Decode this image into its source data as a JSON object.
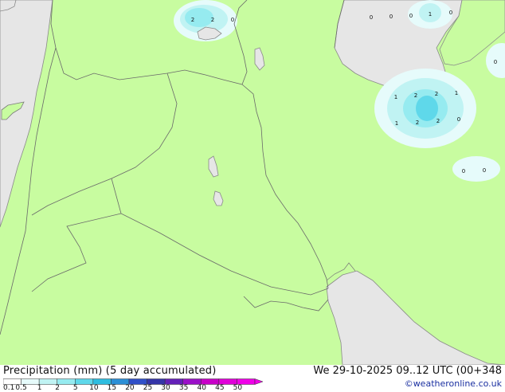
{
  "title": "Precipitation (mm) (5 day accumulated)",
  "datetime": "We 29-10-2025 09..12 UTC (00+348",
  "credit": "©weatheronline.co.uk",
  "legend": {
    "ticks": [
      "0.1",
      "0.5",
      "1",
      "2",
      "5",
      "10",
      "15",
      "20",
      "25",
      "30",
      "35",
      "40",
      "45",
      "50"
    ],
    "colors": [
      "#ffffff",
      "#e6fbfb",
      "#c0f3f3",
      "#96ebf0",
      "#5fd8ea",
      "#2fbde0",
      "#2c8fd6",
      "#3050c8",
      "#3535a8",
      "#6420b8",
      "#9a10c8",
      "#c800c8",
      "#e000d8",
      "#f000e8"
    ]
  },
  "map": {
    "land_color": "#c8fca0",
    "sea_color": "#e6e6e6",
    "border_color": "#6a6a6a",
    "contour_values": [
      {
        "v": "2"
      },
      {
        "v": "2"
      },
      {
        "v": "0"
      },
      {
        "v": "0"
      },
      {
        "v": "0"
      },
      {
        "v": "0"
      },
      {
        "v": "1"
      },
      {
        "v": "0"
      },
      {
        "v": "0"
      },
      {
        "v": "1"
      },
      {
        "v": "2"
      },
      {
        "v": "2"
      },
      {
        "v": "1"
      },
      {
        "v": "1"
      },
      {
        "v": "2"
      },
      {
        "v": "2"
      },
      {
        "v": "0"
      },
      {
        "v": "0"
      },
      {
        "v": "0"
      }
    ]
  }
}
